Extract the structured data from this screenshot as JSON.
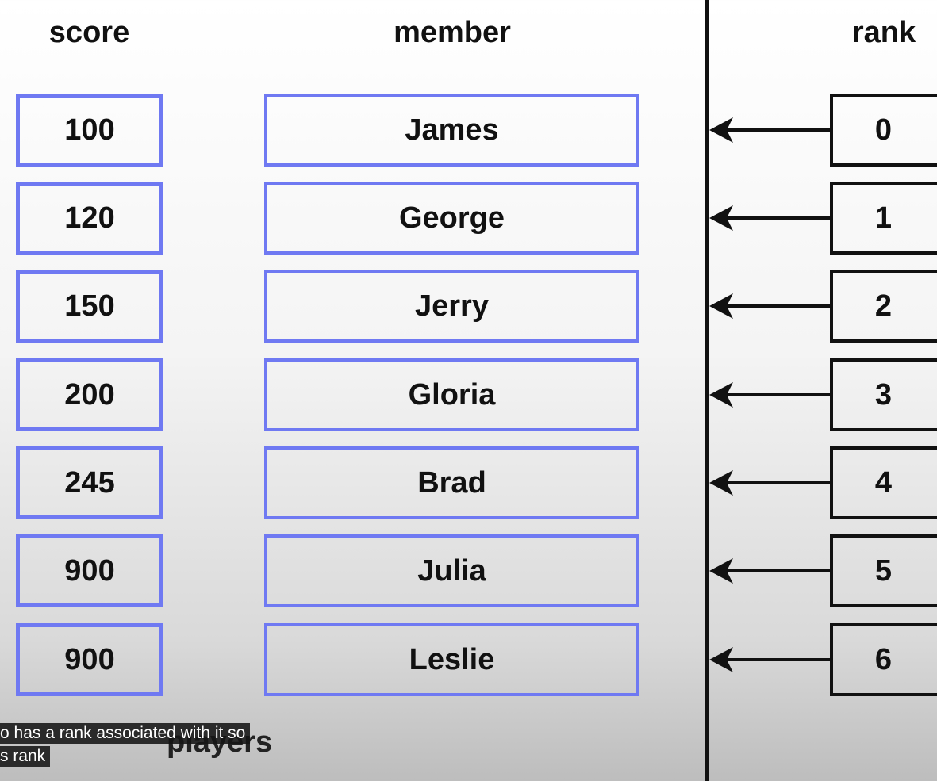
{
  "headers": {
    "score": "score",
    "member": "member",
    "rank": "rank"
  },
  "rows": [
    {
      "score": "100",
      "member": "James",
      "rank": "0"
    },
    {
      "score": "120",
      "member": "George",
      "rank": "1"
    },
    {
      "score": "150",
      "member": "Jerry",
      "rank": "2"
    },
    {
      "score": "200",
      "member": "Gloria",
      "rank": "3"
    },
    {
      "score": "245",
      "member": "Brad",
      "rank": "4"
    },
    {
      "score": "900",
      "member": "Julia",
      "rank": "5"
    },
    {
      "score": "900",
      "member": "Leslie",
      "rank": "6"
    }
  ],
  "footer_label": "players",
  "captions": {
    "line1": "o has a rank associated with it so",
    "line2": "s rank"
  },
  "colors": {
    "score_border": "#6f79f2",
    "member_border": "#6f79f2",
    "rank_border": "#111111",
    "divider": "#111111",
    "arrow": "#111111"
  }
}
